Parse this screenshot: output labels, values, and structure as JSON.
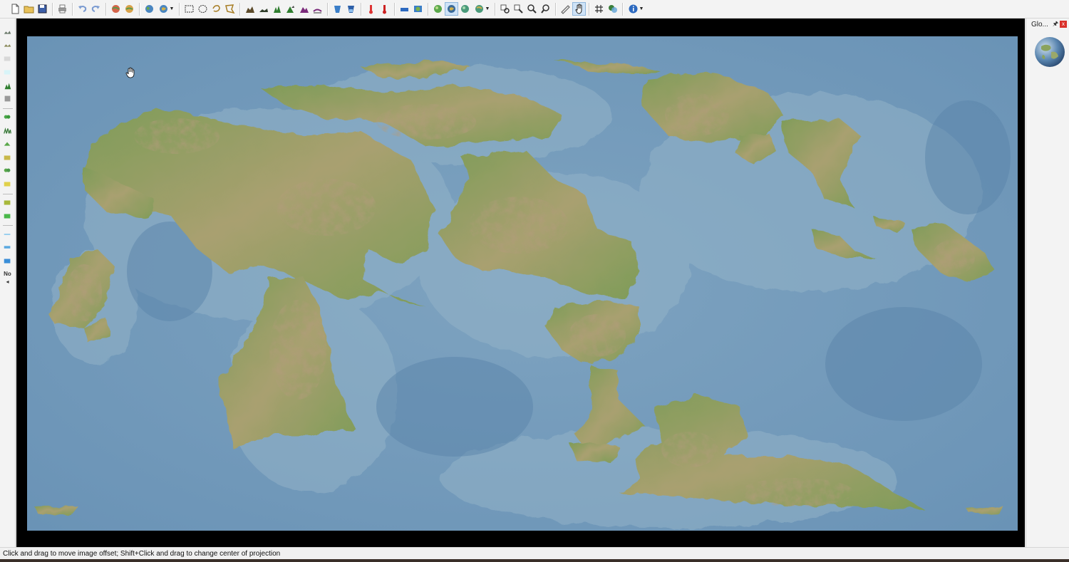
{
  "toolbar": {
    "groups": [
      [
        {
          "icon": "new-file-icon"
        },
        {
          "icon": "open-folder-icon"
        },
        {
          "icon": "save-icon"
        }
      ],
      [
        {
          "icon": "print-icon"
        }
      ],
      [
        {
          "icon": "undo-icon"
        },
        {
          "icon": "redo-icon"
        }
      ],
      [
        {
          "icon": "globe-view-icon"
        },
        {
          "icon": "globe-flat-icon"
        }
      ],
      [
        {
          "icon": "world-icon"
        },
        {
          "icon": "projection-dropdown-icon"
        }
      ],
      [
        {
          "icon": "rect-select-icon"
        },
        {
          "icon": "ellipse-select-icon"
        },
        {
          "icon": "lasso-select-icon"
        },
        {
          "icon": "polygon-select-icon"
        }
      ],
      [
        {
          "icon": "raise-terrain-icon"
        },
        {
          "icon": "lower-terrain-icon"
        },
        {
          "icon": "forest-icon"
        },
        {
          "icon": "peak-icon"
        },
        {
          "icon": "mountain-icon"
        },
        {
          "icon": "smooth-terrain-icon"
        }
      ],
      [
        {
          "icon": "water-bucket-icon"
        },
        {
          "icon": "water-fill-icon"
        }
      ],
      [
        {
          "icon": "temperature-hot-icon"
        },
        {
          "icon": "temperature-cold-icon"
        }
      ],
      [
        {
          "icon": "sea-level-icon"
        },
        {
          "icon": "layer-icon"
        }
      ],
      [
        {
          "icon": "globe-green-icon"
        },
        {
          "icon": "globe-active-icon"
        },
        {
          "icon": "globe-rotate-icon"
        },
        {
          "icon": "globe-options-icon"
        }
      ],
      [
        {
          "icon": "find-icon"
        },
        {
          "icon": "find-replace-icon"
        },
        {
          "icon": "zoom-in-icon"
        },
        {
          "icon": "zoom-out-icon"
        }
      ],
      [
        {
          "icon": "ruler-icon"
        },
        {
          "icon": "hand-pan-icon"
        }
      ],
      [
        {
          "icon": "grid-icon"
        },
        {
          "icon": "palette-icon"
        }
      ],
      [
        {
          "icon": "info-icon"
        }
      ]
    ]
  },
  "left_palette": {
    "items": [
      "tundra-icon",
      "desert-icon",
      "ice-icon",
      "snow-icon",
      "forest-icon",
      "grass-icon",
      "sep",
      "jungle-icon",
      "savanna-icon",
      "broadleaf-icon",
      "scrub-icon",
      "steppe-icon",
      "meadow-icon",
      "sep",
      "marsh-icon",
      "swamp-icon",
      "sep",
      "shallow-water-icon",
      "deep-water-icon",
      "ocean-icon"
    ],
    "no_label": "No",
    "arrow": "◂"
  },
  "right_panel": {
    "title": "Glo...",
    "pin": "🖈",
    "close": "x"
  },
  "status_bar": {
    "text": "Click and drag to move image offset; Shift+Click and drag to change center of projection"
  },
  "colors": {
    "ocean_deep": "#5e88ad",
    "ocean_light": "#8fb0c6",
    "land_low": "#7a9a55",
    "land_mid": "#b5a270",
    "land_high": "#8a6a45"
  }
}
